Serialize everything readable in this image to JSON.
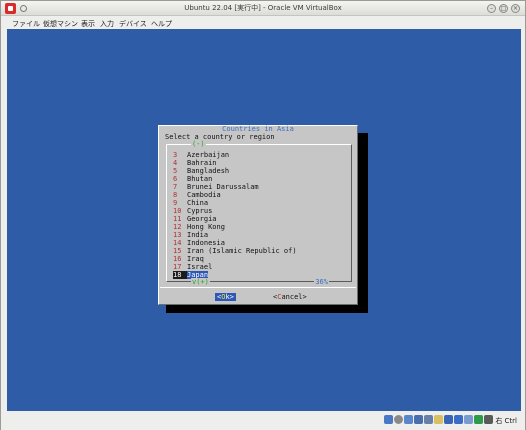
{
  "window": {
    "title": "Ubuntu 22.04 [実行中] - Oracle VM VirtualBox",
    "controls": [
      "minimize",
      "maximize",
      "close"
    ]
  },
  "menubar": {
    "items": [
      "ファイル",
      "仮想マシン",
      "表示",
      "入力",
      "デバイス",
      "ヘルプ"
    ]
  },
  "dialog": {
    "title": "Countries in Asia",
    "prompt": "Select a country or region",
    "top_marker": "(-)",
    "bottom_marker": "v(+)",
    "scroll_percent": "36%",
    "items": [
      {
        "num": "3",
        "name": "Azerbaijan"
      },
      {
        "num": "4",
        "name": "Bahrain"
      },
      {
        "num": "5",
        "name": "Bangladesh"
      },
      {
        "num": "6",
        "name": "Bhutan"
      },
      {
        "num": "7",
        "name": "Brunei Darussalam"
      },
      {
        "num": "8",
        "name": "Cambodia"
      },
      {
        "num": "9",
        "name": "China"
      },
      {
        "num": "10",
        "name": "Cyprus"
      },
      {
        "num": "11",
        "name": "Georgia"
      },
      {
        "num": "12",
        "name": "Hong Kong"
      },
      {
        "num": "13",
        "name": "India"
      },
      {
        "num": "14",
        "name": "Indonesia"
      },
      {
        "num": "15",
        "name": "Iran (Islamic Republic of)"
      },
      {
        "num": "16",
        "name": "Iraq"
      },
      {
        "num": "17",
        "name": "Israel"
      },
      {
        "num": "18",
        "name": "Japan"
      }
    ],
    "selected_index": 15,
    "ok_button": {
      "open": "<",
      "hot": "O",
      "rest": "k",
      "close": ">"
    },
    "cancel_button": {
      "open": "<",
      "hot": "C",
      "rest": "ancel",
      "close": ">"
    }
  },
  "statusbar": {
    "host_key": "右 Ctrl",
    "icons": [
      "hard-disk-icon",
      "optical-drive-icon",
      "audio-icon",
      "network-icon",
      "usb-icon",
      "shared-folder-icon",
      "display-icon",
      "recording-icon",
      "cpu-icon",
      "mouse-integration-icon",
      "keyboard-icon"
    ]
  },
  "colors": {
    "screen_bg": "#2e5ca6",
    "dialog_bg": "#c6c6c6",
    "highlight": "#2f58b4",
    "number": "#b03030"
  }
}
